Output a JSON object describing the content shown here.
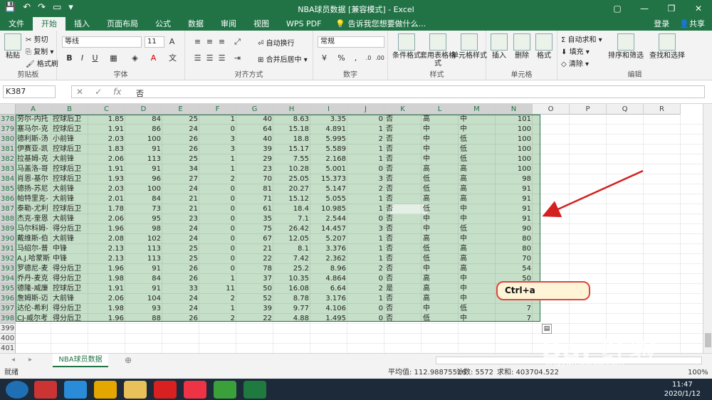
{
  "window": {
    "title": "NBA球员数据 [兼容模式] - Excel",
    "controls": [
      "▢",
      "—",
      "❐",
      "✕"
    ]
  },
  "ribbon_tabs": [
    "文件",
    "开始",
    "插入",
    "页面布局",
    "公式",
    "数据",
    "审阅",
    "视图",
    "WPS PDF"
  ],
  "active_tab_index": 1,
  "tell_me": "告诉我您想要做什么...",
  "account": {
    "signin": "登录",
    "share": "共享"
  },
  "clipboard": {
    "paste": "粘贴",
    "cut": "剪切",
    "copy": "复制",
    "format_painter": "格式刷",
    "label": "剪贴板"
  },
  "font": {
    "name": "等线",
    "size": "11",
    "label": "字体"
  },
  "alignment": {
    "wrap": "自动换行",
    "merge": "合并后居中",
    "label": "对齐方式"
  },
  "number": {
    "format": "常规",
    "label": "数字"
  },
  "styles": {
    "conditional": "条件格式",
    "table": "套用表格格式",
    "cell": "单元格样式",
    "label": "样式"
  },
  "cells": {
    "insert": "插入",
    "delete": "删除",
    "format": "格式",
    "label": "单元格"
  },
  "editing": {
    "autosum": "自动求和",
    "fill": "填充",
    "clear": "清除",
    "sort": "排序和筛选",
    "find": "查找和选择",
    "label": "编辑"
  },
  "formula_bar": {
    "name_box": "K387",
    "value": "否"
  },
  "columns": [
    "A",
    "B",
    "C",
    "D",
    "E",
    "F",
    "G",
    "H",
    "I",
    "J",
    "K",
    "L",
    "M",
    "N",
    "O",
    "P",
    "Q",
    "R"
  ],
  "rows": [
    {
      "n": "378",
      "c": [
        "劳尔-内托",
        "控球后卫",
        "1.85",
        "84",
        "25",
        "1",
        "40",
        "8.63",
        "3.35",
        "0",
        "否",
        "高",
        "中",
        "101"
      ]
    },
    {
      "n": "379",
      "c": [
        "塞马尔-克",
        "控球后卫",
        "1.91",
        "86",
        "24",
        "0",
        "64",
        "15.18",
        "4.891",
        "1",
        "否",
        "中",
        "中",
        "100"
      ]
    },
    {
      "n": "380",
      "c": [
        "德利斯-汤",
        "小前锋",
        "2.03",
        "100",
        "26",
        "3",
        "40",
        "18.8",
        "5.995",
        "2",
        "否",
        "中",
        "低",
        "100"
      ]
    },
    {
      "n": "381",
      "c": [
        "伊赛亚-凯",
        "控球后卫",
        "1.83",
        "91",
        "26",
        "3",
        "39",
        "15.17",
        "5.589",
        "1",
        "否",
        "中",
        "低",
        "100"
      ]
    },
    {
      "n": "382",
      "c": [
        "拉基姆-克",
        "大前锋",
        "2.06",
        "113",
        "25",
        "1",
        "29",
        "7.55",
        "2.168",
        "1",
        "否",
        "中",
        "低",
        "100"
      ]
    },
    {
      "n": "383",
      "c": [
        "马盖洛-哥",
        "控球后卫",
        "1.91",
        "91",
        "34",
        "1",
        "23",
        "10.28",
        "5.001",
        "0",
        "否",
        "高",
        "高",
        "100"
      ]
    },
    {
      "n": "384",
      "c": [
        "肖恩-基尔",
        "控球后卫",
        "1.93",
        "96",
        "27",
        "2",
        "70",
        "25.05",
        "15.373",
        "3",
        "否",
        "低",
        "高",
        "98"
      ]
    },
    {
      "n": "385",
      "c": [
        "德扬-苏尼",
        "大前锋",
        "2.03",
        "100",
        "24",
        "0",
        "81",
        "20.27",
        "5.147",
        "2",
        "否",
        "低",
        "高",
        "91"
      ]
    },
    {
      "n": "386",
      "c": [
        "帕特里克-",
        "大前锋",
        "2.01",
        "84",
        "21",
        "0",
        "71",
        "15.12",
        "5.055",
        "1",
        "否",
        "高",
        "高",
        "91"
      ]
    },
    {
      "n": "387",
      "c": [
        "泰勒-尤利",
        "控球后卫",
        "1.78",
        "73",
        "21",
        "0",
        "61",
        "18.4",
        "10.985",
        "1",
        "否",
        "低",
        "中",
        "91"
      ]
    },
    {
      "n": "388",
      "c": [
        "杰克-奎恩",
        "大前锋",
        "2.06",
        "95",
        "23",
        "0",
        "35",
        "7.1",
        "2.544",
        "0",
        "否",
        "中",
        "中",
        "91"
      ]
    },
    {
      "n": "389",
      "c": [
        "马尔科姆-",
        "得分后卫",
        "1.96",
        "98",
        "24",
        "0",
        "75",
        "26.42",
        "14.457",
        "3",
        "否",
        "中",
        "低",
        "90"
      ]
    },
    {
      "n": "390",
      "c": [
        "戴维斯-伯",
        "大前锋",
        "2.08",
        "102",
        "24",
        "0",
        "67",
        "12.05",
        "5.207",
        "1",
        "否",
        "高",
        "中",
        "80"
      ]
    },
    {
      "n": "391",
      "c": [
        "马绍尔-普",
        "中锋",
        "2.13",
        "113",
        "25",
        "0",
        "21",
        "8.1",
        "3.376",
        "1",
        "否",
        "低",
        "高",
        "80"
      ]
    },
    {
      "n": "392",
      "c": [
        "A.J.哈蒙斯",
        "中锋",
        "2.13",
        "113",
        "25",
        "0",
        "22",
        "7.42",
        "2.362",
        "1",
        "否",
        "低",
        "高",
        "70"
      ]
    },
    {
      "n": "393",
      "c": [
        "罗德尼-麦",
        "得分后卫",
        "1.96",
        "91",
        "26",
        "0",
        "78",
        "25.2",
        "8.96",
        "2",
        "否",
        "中",
        "高",
        "54"
      ]
    },
    {
      "n": "394",
      "c": [
        "乔丹-麦克",
        "得分后卫",
        "1.98",
        "84",
        "26",
        "1",
        "37",
        "10.35",
        "4.864",
        "0",
        "否",
        "高",
        "中",
        "50"
      ]
    },
    {
      "n": "395",
      "c": [
        "德隆-威廉",
        "控球后卫",
        "1.91",
        "91",
        "33",
        "11",
        "50",
        "16.08",
        "6.64",
        "2",
        "是",
        "高",
        "中",
        ""
      ]
    },
    {
      "n": "396",
      "c": [
        "詹姆斯-迈",
        "大前锋",
        "2.06",
        "104",
        "24",
        "2",
        "52",
        "8.78",
        "3.176",
        "1",
        "否",
        "高",
        "中",
        ""
      ]
    },
    {
      "n": "397",
      "c": [
        "达伦-希利",
        "得分后卫",
        "1.98",
        "93",
        "24",
        "1",
        "39",
        "9.77",
        "4.106",
        "0",
        "否",
        "中",
        "低",
        "7"
      ]
    },
    {
      "n": "398",
      "c": [
        "CJ-威尔考",
        "得分后卫",
        "1.96",
        "88",
        "26",
        "2",
        "22",
        "4.88",
        "1.495",
        "0",
        "否",
        "低",
        "中",
        "7"
      ]
    },
    {
      "n": "399",
      "c": []
    },
    {
      "n": "400",
      "c": []
    },
    {
      "n": "401",
      "c": []
    }
  ],
  "sheet_tab": "NBA球员数据",
  "status": {
    "ready": "就绪",
    "average": "平均值: 112.98875516",
    "count": "计数: 5572",
    "sum": "求和: 403704.522",
    "zoom": "100%"
  },
  "annotation": {
    "text": "Ctrl+a"
  },
  "watermark": {
    "text": "Bai 经验",
    "url": "jingyan.baidu.com"
  },
  "taskbar": {
    "time": "11:47",
    "date": "2020/1/12",
    "apps": [
      "start",
      "app-1",
      "sogou",
      "chrome",
      "explorer",
      "youdao",
      "app-2",
      "wechat",
      "excel"
    ],
    "app_colors": [
      "#1f6fb5",
      "#c33",
      "#2a8bd8",
      "#e6a600",
      "#e8c15a",
      "#d92020",
      "#e34",
      "#3aa13a",
      "#1f7a3f"
    ]
  },
  "colors": {
    "excel_green": "#217346",
    "selection": "#c6dfc8"
  }
}
